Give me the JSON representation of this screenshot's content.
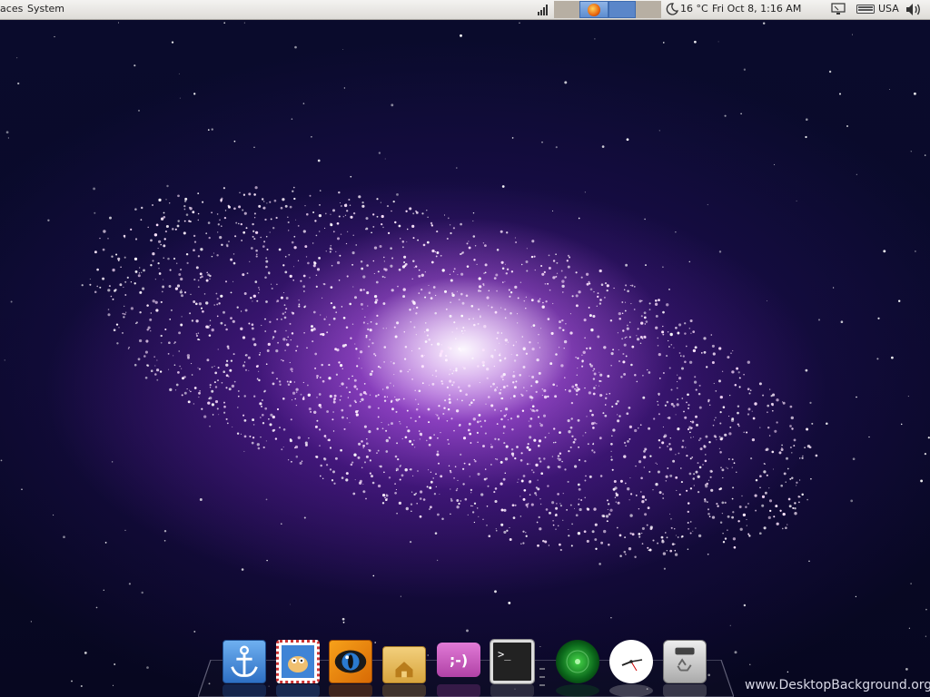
{
  "top_panel": {
    "menus": [
      "laces",
      "System"
    ],
    "taskbar": {
      "items": [
        {
          "icon": "firefox-icon"
        },
        {
          "icon": "active-window"
        }
      ]
    },
    "weather": {
      "icon": "weather-moon-icon",
      "temperature": "16 °C"
    },
    "clock": "Fri Oct  8,  1:16 AM",
    "keyboard_layout": "USA",
    "indicators": [
      "signal-icon",
      "display-icon",
      "keyboard-icon",
      "volume-icon"
    ]
  },
  "dock": {
    "items": [
      {
        "name": "anchor",
        "icon": "anchor-icon"
      },
      {
        "name": "mail",
        "icon": "mail-stamp-icon"
      },
      {
        "name": "eye",
        "icon": "eye-icon"
      },
      {
        "name": "home-folder",
        "icon": "home-folder-icon"
      },
      {
        "name": "chat",
        "icon": "chat-bubble-icon",
        "glyph": ";-)"
      },
      {
        "name": "terminal",
        "icon": "terminal-icon",
        "glyph": ">_"
      },
      {
        "name": "radar",
        "icon": "radar-icon"
      },
      {
        "name": "clock",
        "icon": "clock-icon"
      },
      {
        "name": "trash",
        "icon": "trash-icon"
      }
    ]
  },
  "wallpaper": {
    "subject": "galaxy",
    "watermark": "www.DesktopBackground.org"
  },
  "colors": {
    "panel_bg": "#e8e6e2",
    "taskbar_active": "#5a86c9",
    "galaxy_core": "#ffffff",
    "galaxy_glow": "#b050e0",
    "space": "#070720"
  }
}
